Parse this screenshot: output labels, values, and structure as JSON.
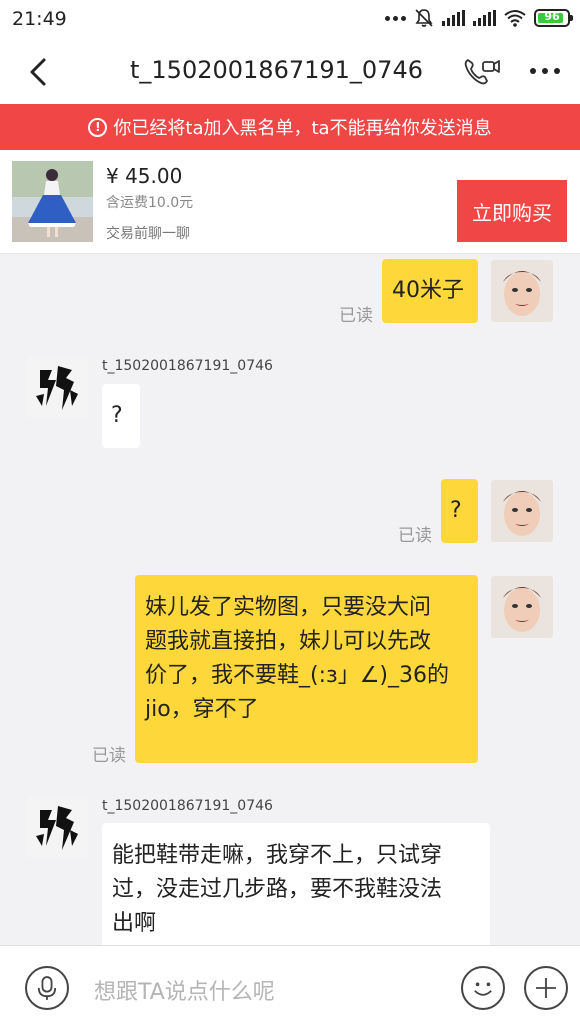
{
  "status_bar": {
    "time": "21:49",
    "battery": "96"
  },
  "header": {
    "title": "t_1502001867191_0746"
  },
  "banner": {
    "info_glyph": "!",
    "text": "你已经将ta加入黑名单，ta不能再给你发送消息"
  },
  "product": {
    "price": "¥ 45.00",
    "shipping": "含运费10.0元",
    "chat_before": "交易前聊一聊",
    "buy_label": "立即购买"
  },
  "messages": [
    {
      "from": "me",
      "text": "40米子",
      "status": "已读"
    },
    {
      "from": "them",
      "sender": "t_1502001867191_0746",
      "text": "?"
    },
    {
      "from": "me",
      "text": "?",
      "status": "已读"
    },
    {
      "from": "me",
      "lines": [
        "妹儿发了实物图，只要没大问",
        "题我就直接拍，妹儿可以先改",
        "价了，我不要鞋_(:з」∠)_36的",
        "jio，穿不了"
      ],
      "status": "已读"
    },
    {
      "from": "them",
      "sender": "t_1502001867191_0746",
      "lines": [
        "能把鞋带走嘛，我穿不上，只试穿",
        "过，没走过几步路，要不我鞋没法",
        "出啊"
      ]
    }
  ],
  "input": {
    "placeholder": "想跟TA说点什么呢"
  },
  "colors": {
    "accent_red": "#f04646",
    "bubble_yellow": "#fed83a",
    "bg": "#f2f2f5"
  },
  "icons": [
    "back-arrow-icon",
    "video-call-icon",
    "more-icon",
    "mic-icon",
    "emoji-icon",
    "plus-icon"
  ]
}
